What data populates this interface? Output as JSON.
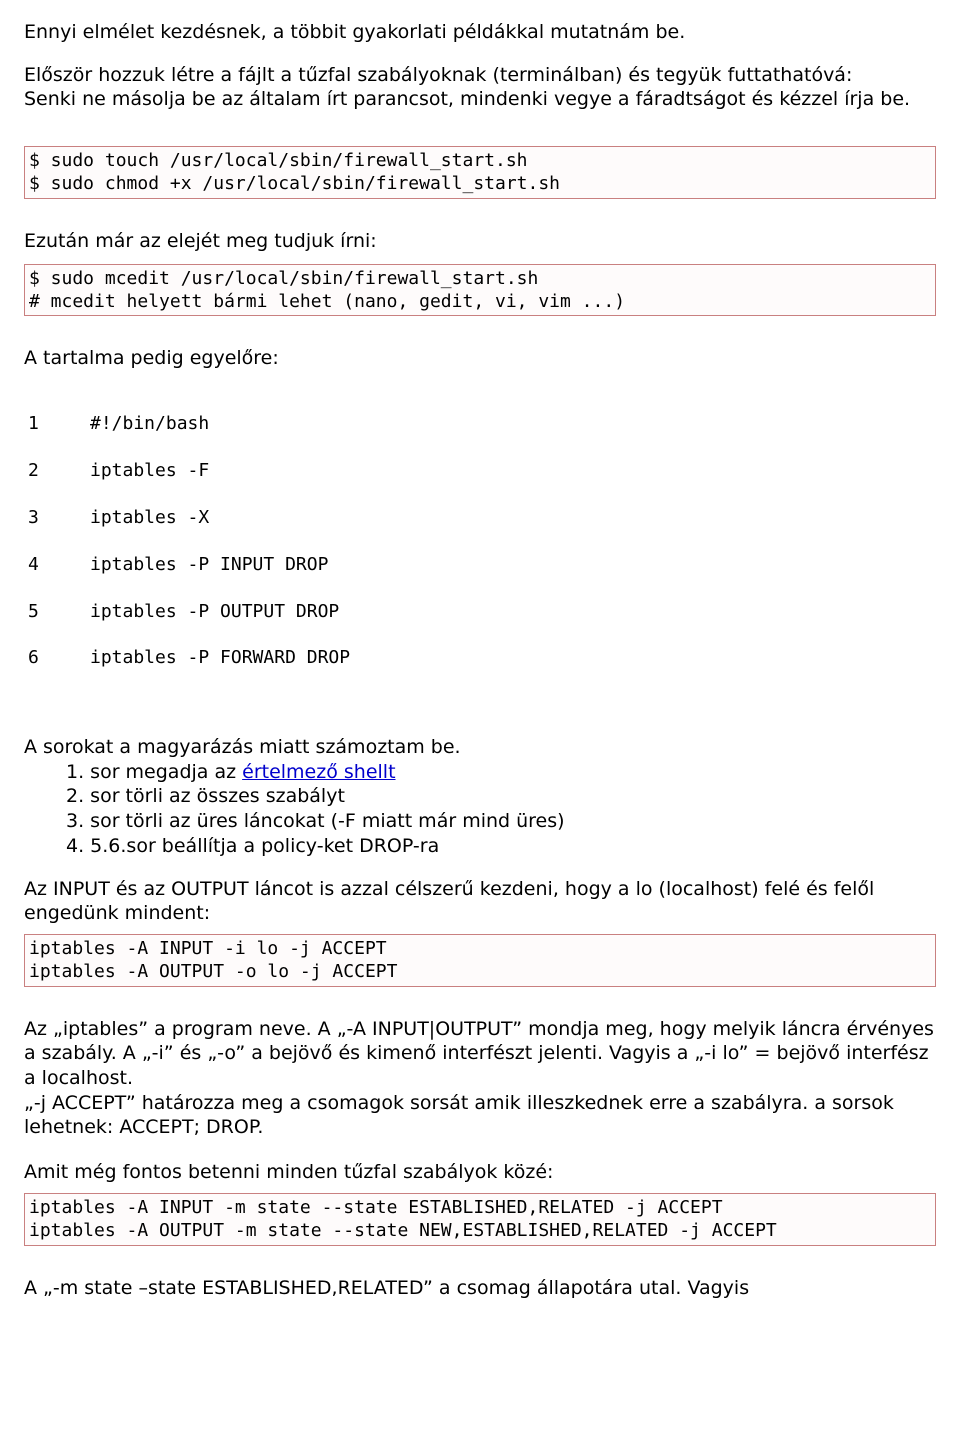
{
  "p1": "Ennyi elmélet kezdésnek, a többit gyakorlati példákkal mutatnám be.",
  "p2": "Először hozzuk létre a fájlt a tűzfal szabályoknak (terminálban) és tegyük futtathatóvá:",
  "p2b": "Senki ne másolja be az általam írt parancsot, mindenki vegye a fáradtságot és kézzel írja be.",
  "code1_l1": "$ sudo touch /usr/local/sbin/firewall_start.sh",
  "code1_l2": "$ sudo chmod +x /usr/local/sbin/firewall_start.sh",
  "p3": "Ezután már az elejét meg tudjuk írni:",
  "code2_l1": "$ sudo mcedit /usr/local/sbin/firewall_start.sh",
  "code2_l2": "# mcedit helyett bármi lehet (nano, gedit, vi, vim ...)",
  "p4": "A tartalma pedig egyelőre:",
  "num": {
    "n1": "1",
    "c1": "#!/bin/bash",
    "n2": "2",
    "c2": "iptables -F",
    "n3": "3",
    "c3": "iptables -X",
    "n4": "4",
    "c4": "iptables -P INPUT DROP",
    "n5": "5",
    "c5": "iptables -P OUTPUT DROP",
    "n6": "6",
    "c6": "iptables -P FORWARD DROP"
  },
  "p5": "A sorokat a magyarázás miatt számoztam be.",
  "list": {
    "r1a": "1. sor    megadja az ",
    "r1link": "értelmező shellt",
    "r2": "2. sor    törli az összes szabályt",
    "r3": "3. sor    törli az üres láncokat (-F miatt már mind üres)",
    "r4": "4. 5.6.sor beállítja a policy-ket DROP-ra"
  },
  "p6": "Az INPUT és az OUTPUT láncot is azzal célszerű kezdeni, hogy a lo (localhost) felé és felől engedünk mindent:",
  "code3_l1": "iptables -A INPUT -i lo -j ACCEPT",
  "code3_l2": "iptables -A OUTPUT -o lo -j ACCEPT",
  "p7": "Az „iptables” a program neve. A „-A INPUT|OUTPUT” mondja meg, hogy melyik láncra érvényes a szabály. A „-i” és „-o” a bejövő  és kimenő interfészt jelenti. Vagyis a „-i lo” = bejövő interfész a localhost.",
  "p7b": "„-j ACCEPT” határozza meg a csomagok sorsát amik illeszkednek erre a szabályra. a sorsok lehetnek: ACCEPT; DROP.",
  "p8": "Amit még fontos betenni minden tűzfal szabályok közé:",
  "code4_l1": "iptables -A INPUT -m state --state ESTABLISHED,RELATED -j ACCEPT",
  "code4_l2": "iptables -A OUTPUT -m state --state NEW,ESTABLISHED,RELATED -j ACCEPT",
  "p9": "A „-m state –state ESTABLISHED,RELATED” a csomag állapotára utal. Vagyis"
}
